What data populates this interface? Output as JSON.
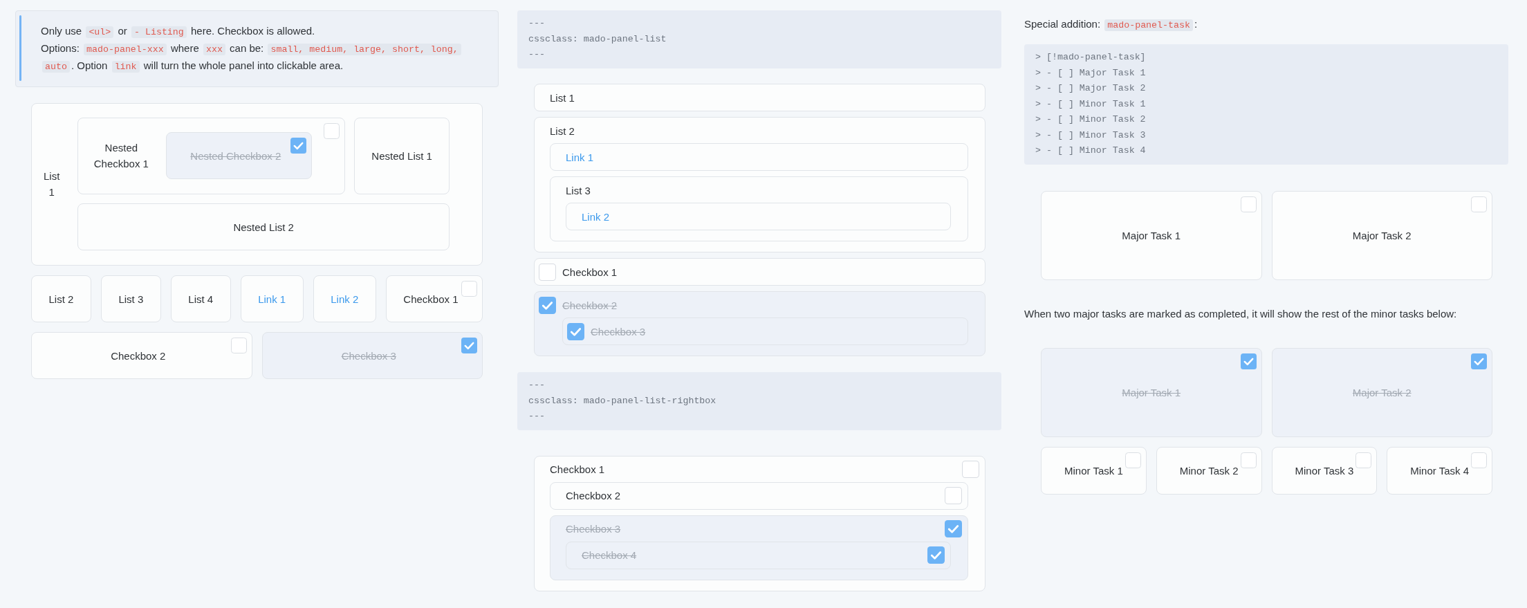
{
  "callout": {
    "paragraphs": [
      [
        {
          "kind": "text",
          "text": "Only use "
        },
        {
          "kind": "code",
          "text": "<ul>"
        },
        {
          "kind": "text",
          "text": " or "
        },
        {
          "kind": "code",
          "text": "- Listing"
        },
        {
          "kind": "text",
          "text": " here. Checkbox is allowed."
        }
      ],
      [
        {
          "kind": "text",
          "text": "Options: "
        },
        {
          "kind": "code",
          "text": "mado-panel-xxx"
        },
        {
          "kind": "text",
          "text": " where "
        },
        {
          "kind": "code",
          "text": "xxx"
        },
        {
          "kind": "text",
          "text": " can be: "
        },
        {
          "kind": "code",
          "text": "small, medium, large, short, long, auto"
        },
        {
          "kind": "text",
          "text": ". Option "
        },
        {
          "kind": "code",
          "text": "link"
        },
        {
          "kind": "text",
          "text": " will turn the whole panel into clickable area."
        }
      ]
    ]
  },
  "grid_panel": {
    "items": [
      {
        "kind": "list",
        "label": "List 1",
        "children": [
          {
            "kind": "checkbox",
            "label": "Nested Checkbox 1",
            "checked": false,
            "children": [
              {
                "kind": "checkbox",
                "label": "Nested Checkbox 2",
                "checked": true
              }
            ]
          },
          {
            "kind": "list",
            "label": "Nested List 1"
          },
          {
            "kind": "list",
            "label": "Nested List 2"
          }
        ]
      },
      {
        "kind": "list",
        "label": "List 2"
      },
      {
        "kind": "list",
        "label": "List 3"
      },
      {
        "kind": "list",
        "label": "List 4"
      },
      {
        "kind": "link",
        "label": "Link 1"
      },
      {
        "kind": "link",
        "label": "Link 2"
      },
      {
        "kind": "checkbox",
        "label": "Checkbox 1",
        "checked": false
      },
      {
        "kind": "checkbox",
        "label": "Checkbox 2",
        "checked": false
      },
      {
        "kind": "checkbox",
        "label": "Checkbox 3",
        "checked": true
      }
    ]
  },
  "list_code_block": {
    "lines": [
      "---",
      "cssclass: mado-panel-list",
      "---"
    ]
  },
  "list_panel": {
    "items": [
      {
        "kind": "list",
        "label": "List 1"
      },
      {
        "kind": "list",
        "label": "List 2",
        "children": [
          {
            "kind": "link",
            "label": "Link 1"
          },
          {
            "kind": "list",
            "label": "List 3",
            "children": [
              {
                "kind": "link",
                "label": "Link 2"
              }
            ]
          }
        ]
      },
      {
        "kind": "checkbox",
        "label": "Checkbox 1",
        "checked": false
      },
      {
        "kind": "checkbox",
        "label": "Checkbox 2",
        "checked": true,
        "children": [
          {
            "kind": "checkbox",
            "label": "Checkbox 3",
            "checked": true
          }
        ]
      }
    ]
  },
  "rightbox_code_block": {
    "lines": [
      "---",
      "cssclass: mado-panel-list-rightbox",
      "---"
    ]
  },
  "rightbox_panel": {
    "items": [
      {
        "kind": "checkbox",
        "label": "Checkbox 1",
        "checked": false,
        "children": [
          {
            "kind": "checkbox",
            "label": "Checkbox 2",
            "checked": false
          },
          {
            "kind": "checkbox",
            "label": "Checkbox 3",
            "checked": true,
            "children": [
              {
                "kind": "checkbox",
                "label": "Checkbox 4",
                "checked": true
              }
            ]
          }
        ]
      }
    ]
  },
  "task_intro": {
    "segments": [
      {
        "kind": "text",
        "text": "Special addition: "
      },
      {
        "kind": "code",
        "text": "mado-panel-task"
      },
      {
        "kind": "text",
        "text": ":"
      }
    ]
  },
  "task_code_block": {
    "lines": [
      "> [!mado-panel-task]",
      "> - [ ] Major Task 1",
      "> - [ ] Major Task 2",
      "> - [ ] Minor Task 1",
      "> - [ ] Minor Task 2",
      "> - [ ] Minor Task 3",
      "> - [ ] Minor Task 4"
    ]
  },
  "task_panel": {
    "tasks": [
      {
        "kind": "major",
        "label": "Major Task 1",
        "checked": false
      },
      {
        "kind": "major",
        "label": "Major Task 2",
        "checked": false
      }
    ]
  },
  "task_note": "When two major tasks are marked as completed, it will show the rest of the minor tasks below:",
  "completed_task_panel": {
    "tasks": [
      {
        "kind": "major",
        "label": "Major Task 1",
        "checked": true
      },
      {
        "kind": "major",
        "label": "Major Task 2",
        "checked": true
      },
      {
        "kind": "minor",
        "label": "Minor Task 1",
        "checked": false
      },
      {
        "kind": "minor",
        "label": "Minor Task 2",
        "checked": false
      },
      {
        "kind": "minor",
        "label": "Minor Task 3",
        "checked": false
      },
      {
        "kind": "minor",
        "label": "Minor Task 4",
        "checked": false
      }
    ]
  }
}
